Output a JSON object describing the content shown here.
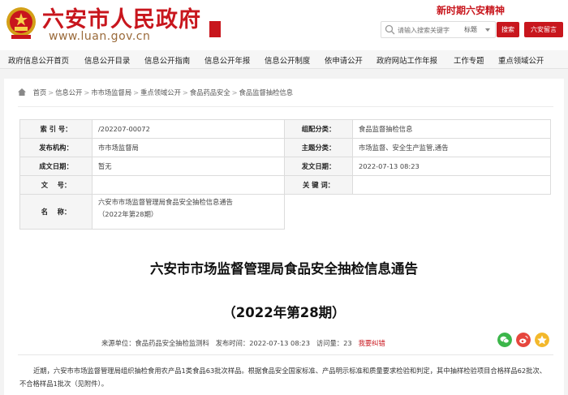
{
  "header": {
    "site_title": "六安市人民政府",
    "site_url": "www.luan.gov.cn",
    "seal_text": "六安 市府",
    "slogan": "新时期六安精神",
    "search_placeholder": "请输入搜索关键字",
    "search_scope": "标题",
    "search_button": "搜索",
    "mail_button": "六安留言"
  },
  "nav": {
    "items": [
      "政府信息公开首页",
      "信息公开目录",
      "信息公开指南",
      "信息公开年报",
      "信息公开制度",
      "依申请公开",
      "政府网站工作年报",
      "工作专题",
      "重点领域公开"
    ]
  },
  "breadcrumb": {
    "items": [
      "首页",
      "信息公开",
      "市市场监督局",
      "重点领域公开",
      "食品药品安全",
      "食品监督抽检信息"
    ],
    "separator": ">"
  },
  "meta": {
    "index_label": "索 引 号：",
    "index_value": "/202207-00072",
    "category_label": "组配分类：",
    "category_value": "食品监督抽检信息",
    "publisher_label": "发布机构：",
    "publisher_value": "市市场监督局",
    "topic_label": "主题分类：",
    "topic_value": "市场监督、安全生产监管,通告",
    "created_label": "成文日期：",
    "created_value": "暂无",
    "published_label": "发文日期：",
    "published_value": "2022-07-13 08:23",
    "docno_label": "文    号：",
    "docno_value": "",
    "keywords_label": "关 键 词：",
    "keywords_value": "",
    "name_label": "名    称：",
    "name_line1": "六安市市场监督管理局食品安全抽检信息通告",
    "name_line2": "（2022年第28期）"
  },
  "article": {
    "title": "六安市市场监督管理局食品安全抽检信息通告",
    "subtitle": "（2022年第28期）",
    "source_label": "来源单位：",
    "source_value": "食品药品安全抽检监测科",
    "time_label": "发布时间：",
    "time_value": "2022-07-13 08:23",
    "views_label": "访问量：",
    "views_value": "23",
    "report_error": "我要纠错",
    "body": "近期，六安市市场监督管理局组织抽检食用农产品1类食品63批次样品。根据食品安全国家标准、产品明示标准和质量要求检验和判定，其中抽样检验项目合格样品62批次、不合格样品1批次（见附件）。"
  },
  "share": {
    "icons": [
      "wechat-icon",
      "weibo-icon",
      "qzone-icon"
    ]
  },
  "colors": {
    "brand_red": "#c8161d",
    "wechat_green": "#3bb64a",
    "weibo_red": "#e6463d",
    "qzone_yellow": "#f3b82b"
  }
}
